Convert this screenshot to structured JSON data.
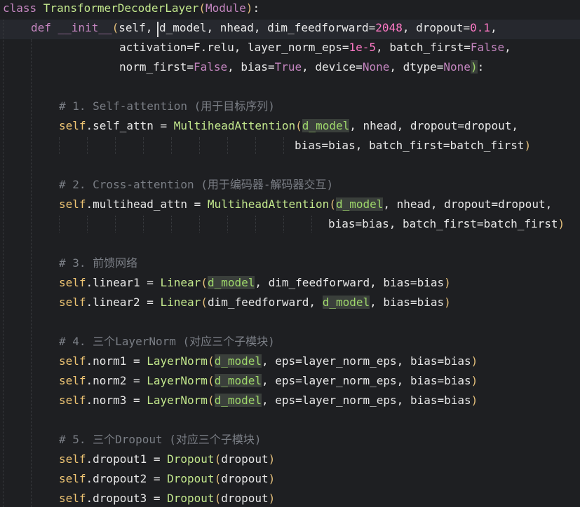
{
  "editor": {
    "lines": [
      {
        "indent": 0,
        "tokens": [
          {
            "t": "class ",
            "c": "c-def"
          },
          {
            "t": "TransformerDecoderLayer",
            "c": "c-title"
          },
          {
            "t": "(",
            "c": "c-paren"
          },
          {
            "t": "Module",
            "c": "c-module"
          },
          {
            "t": ")",
            "c": "c-paren"
          },
          {
            "t": ":",
            "c": "c-default"
          }
        ]
      },
      {
        "indent": 40,
        "tokens": [
          {
            "t": "def ",
            "c": "c-def"
          },
          {
            "t": "__init__",
            "c": "c-def"
          },
          {
            "t": "(",
            "c": "c-paren"
          },
          {
            "t": "self",
            "c": "c-default"
          },
          {
            "t": ", ",
            "c": "c-default"
          },
          {
            "t": "d_model",
            "c": "c-default"
          },
          {
            "t": ", nhead, dim_feedforward=",
            "c": "c-default"
          },
          {
            "t": "2048",
            "c": "c-num"
          },
          {
            "t": ", dropout=",
            "c": "c-default"
          },
          {
            "t": "0.1",
            "c": "c-num"
          },
          {
            "t": ",",
            "c": "c-default"
          }
        ]
      },
      {
        "indent": 166,
        "tokens": [
          {
            "t": "activation=F.relu, layer_norm_eps=",
            "c": "c-default"
          },
          {
            "t": "1e-5",
            "c": "c-num"
          },
          {
            "t": ", batch_first=",
            "c": "c-default"
          },
          {
            "t": "False",
            "c": "c-false"
          },
          {
            "t": ",",
            "c": "c-default"
          }
        ]
      },
      {
        "indent": 166,
        "tokens": [
          {
            "t": "norm_first=",
            "c": "c-default"
          },
          {
            "t": "False",
            "c": "c-false"
          },
          {
            "t": ", bias=",
            "c": "c-default"
          },
          {
            "t": "True",
            "c": "c-false"
          },
          {
            "t": ", device=",
            "c": "c-default"
          },
          {
            "t": "None",
            "c": "c-false"
          },
          {
            "t": ", dtype=",
            "c": "c-default"
          },
          {
            "t": "None",
            "c": "c-false"
          },
          {
            "t": ")",
            "c": "c-paren c-hl"
          },
          {
            "t": ":",
            "c": "c-default"
          }
        ]
      },
      {
        "indent": 0,
        "tokens": []
      },
      {
        "indent": 80,
        "tokens": [
          {
            "t": "# 1. Self-attention (用于目标序列)",
            "c": "c-comment"
          }
        ]
      },
      {
        "indent": 80,
        "tokens": [
          {
            "t": "self",
            "c": "c-selfkw"
          },
          {
            "t": ".self_attn = ",
            "c": "c-default"
          },
          {
            "t": "MultiheadAttention",
            "c": "c-title"
          },
          {
            "t": "(",
            "c": "c-paren"
          },
          {
            "t": "d_model",
            "c": "c-hl"
          },
          {
            "t": ", nhead, dropout=dropout,",
            "c": "c-default"
          }
        ]
      },
      {
        "indent": 416,
        "tokens": [
          {
            "t": "bias=bias, batch_first=batch_first",
            "c": "c-default"
          },
          {
            "t": ")",
            "c": "c-paren"
          }
        ]
      },
      {
        "indent": 0,
        "tokens": []
      },
      {
        "indent": 80,
        "tokens": [
          {
            "t": "# 2. Cross-attention (用于编码器-解码器交互)",
            "c": "c-comment"
          }
        ]
      },
      {
        "indent": 80,
        "tokens": [
          {
            "t": "self",
            "c": "c-selfkw"
          },
          {
            "t": ".multihead_attn = ",
            "c": "c-default"
          },
          {
            "t": "MultiheadAttention",
            "c": "c-title"
          },
          {
            "t": "(",
            "c": "c-paren"
          },
          {
            "t": "d_model",
            "c": "c-hl"
          },
          {
            "t": ", nhead, dropout=dropout,",
            "c": "c-default"
          }
        ]
      },
      {
        "indent": 464,
        "tokens": [
          {
            "t": "bias=bias, batch_first=batch_first",
            "c": "c-default"
          },
          {
            "t": ")",
            "c": "c-paren"
          }
        ]
      },
      {
        "indent": 0,
        "tokens": []
      },
      {
        "indent": 80,
        "tokens": [
          {
            "t": "# 3. 前馈网络",
            "c": "c-comment"
          }
        ]
      },
      {
        "indent": 80,
        "tokens": [
          {
            "t": "self",
            "c": "c-selfkw"
          },
          {
            "t": ".linear1 = ",
            "c": "c-default"
          },
          {
            "t": "Linear",
            "c": "c-title"
          },
          {
            "t": "(",
            "c": "c-paren"
          },
          {
            "t": "d_model",
            "c": "c-hl"
          },
          {
            "t": ", dim_feedforward, bias=bias",
            "c": "c-default"
          },
          {
            "t": ")",
            "c": "c-paren"
          }
        ]
      },
      {
        "indent": 80,
        "tokens": [
          {
            "t": "self",
            "c": "c-selfkw"
          },
          {
            "t": ".linear2 = ",
            "c": "c-default"
          },
          {
            "t": "Linear",
            "c": "c-title"
          },
          {
            "t": "(",
            "c": "c-paren"
          },
          {
            "t": "dim_feedforward, ",
            "c": "c-default"
          },
          {
            "t": "d_model",
            "c": "c-hl"
          },
          {
            "t": ", bias=bias",
            "c": "c-default"
          },
          {
            "t": ")",
            "c": "c-paren"
          }
        ]
      },
      {
        "indent": 0,
        "tokens": []
      },
      {
        "indent": 80,
        "tokens": [
          {
            "t": "# 4. 三个LayerNorm (对应三个子模块)",
            "c": "c-comment"
          }
        ]
      },
      {
        "indent": 80,
        "tokens": [
          {
            "t": "self",
            "c": "c-selfkw"
          },
          {
            "t": ".norm1 = ",
            "c": "c-default"
          },
          {
            "t": "LayerNorm",
            "c": "c-title"
          },
          {
            "t": "(",
            "c": "c-paren"
          },
          {
            "t": "d_model",
            "c": "c-hl"
          },
          {
            "t": ", eps=layer_norm_eps, bias=bias",
            "c": "c-default"
          },
          {
            "t": ")",
            "c": "c-paren"
          }
        ]
      },
      {
        "indent": 80,
        "tokens": [
          {
            "t": "self",
            "c": "c-selfkw"
          },
          {
            "t": ".norm2 = ",
            "c": "c-default"
          },
          {
            "t": "LayerNorm",
            "c": "c-title"
          },
          {
            "t": "(",
            "c": "c-paren"
          },
          {
            "t": "d_model",
            "c": "c-hl"
          },
          {
            "t": ", eps=layer_norm_eps, bias=bias",
            "c": "c-default"
          },
          {
            "t": ")",
            "c": "c-paren"
          }
        ]
      },
      {
        "indent": 80,
        "tokens": [
          {
            "t": "self",
            "c": "c-selfkw"
          },
          {
            "t": ".norm3 = ",
            "c": "c-default"
          },
          {
            "t": "LayerNorm",
            "c": "c-title"
          },
          {
            "t": "(",
            "c": "c-paren"
          },
          {
            "t": "d_model",
            "c": "c-hl"
          },
          {
            "t": ", eps=layer_norm_eps, bias=bias",
            "c": "c-default"
          },
          {
            "t": ")",
            "c": "c-paren"
          }
        ]
      },
      {
        "indent": 0,
        "tokens": []
      },
      {
        "indent": 80,
        "tokens": [
          {
            "t": "# 5. 三个Dropout (对应三个子模块)",
            "c": "c-comment"
          }
        ]
      },
      {
        "indent": 80,
        "tokens": [
          {
            "t": "self",
            "c": "c-selfkw"
          },
          {
            "t": ".dropout1 = ",
            "c": "c-default"
          },
          {
            "t": "Dropout",
            "c": "c-title"
          },
          {
            "t": "(",
            "c": "c-paren"
          },
          {
            "t": "dropout",
            "c": "c-default"
          },
          {
            "t": ")",
            "c": "c-paren"
          }
        ]
      },
      {
        "indent": 80,
        "tokens": [
          {
            "t": "self",
            "c": "c-selfkw"
          },
          {
            "t": ".dropout2 = ",
            "c": "c-default"
          },
          {
            "t": "Dropout",
            "c": "c-title"
          },
          {
            "t": "(",
            "c": "c-paren"
          },
          {
            "t": "dropout",
            "c": "c-default"
          },
          {
            "t": ")",
            "c": "c-paren"
          }
        ]
      },
      {
        "indent": 80,
        "tokens": [
          {
            "t": "self",
            "c": "c-selfkw"
          },
          {
            "t": ".dropout3 = ",
            "c": "c-default"
          },
          {
            "t": "Dropout",
            "c": "c-title"
          },
          {
            "t": "(",
            "c": "c-paren"
          },
          {
            "t": "dropout",
            "c": "c-default"
          },
          {
            "t": ")",
            "c": "c-paren"
          }
        ]
      }
    ]
  }
}
